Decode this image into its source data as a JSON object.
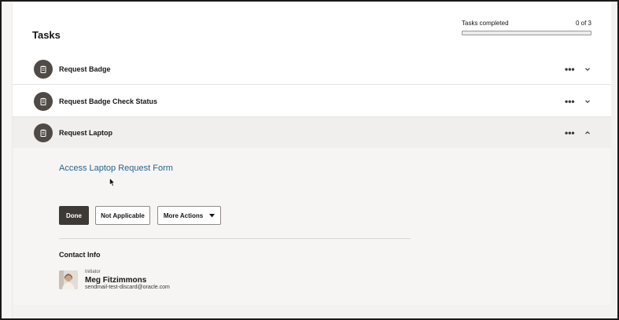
{
  "header": {
    "title": "Tasks"
  },
  "progress": {
    "label": "Tasks completed",
    "count_text": "0 of 3",
    "fraction": 0
  },
  "tasks": [
    {
      "title": "Request Badge",
      "menu_icon": "more-horizontal-icon",
      "chevron_icon": "chevron-down-icon",
      "expanded": false
    },
    {
      "title": "Request Badge Check Status",
      "menu_icon": "more-horizontal-icon",
      "chevron_icon": "chevron-down-icon",
      "expanded": false
    },
    {
      "title": "Request Laptop",
      "menu_icon": "more-horizontal-icon",
      "chevron_icon": "chevron-up-icon",
      "expanded": true
    }
  ],
  "task_icon": "clipboard-icon",
  "expanded_task": {
    "link_text": "Access Laptop Request Form",
    "actions": {
      "done": "Done",
      "not_applicable": "Not Applicable",
      "more_actions": "More Actions"
    },
    "contact": {
      "heading": "Contact Info",
      "role": "Initiator",
      "name": "Meg Fitzimmons",
      "email": "sendmail-test-discard@oracle.com"
    }
  },
  "colors": {
    "accent_link": "#26648e",
    "primary_button": "#3d3935",
    "task_icon_bg": "#4f4a45",
    "expanded_row_bg": "#f1efed"
  }
}
